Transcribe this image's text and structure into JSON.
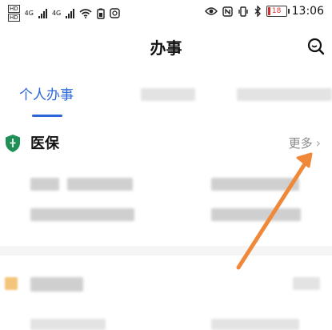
{
  "status_bar": {
    "time": "13:06",
    "battery": "18",
    "network1": "4G",
    "network2": "4G"
  },
  "header": {
    "title": "办事"
  },
  "tabs": {
    "active_label": "个人办事"
  },
  "section_medical": {
    "title": "医保",
    "more_label": "更多"
  },
  "colors": {
    "accent": "#2a66d9",
    "shield": "#1f8f57",
    "annotation_arrow": "#f0883a"
  },
  "icons": [
    "search-icon",
    "shield-icon",
    "chevron-right-icon",
    "wifi-icon",
    "bluetooth-icon",
    "eye-icon"
  ]
}
